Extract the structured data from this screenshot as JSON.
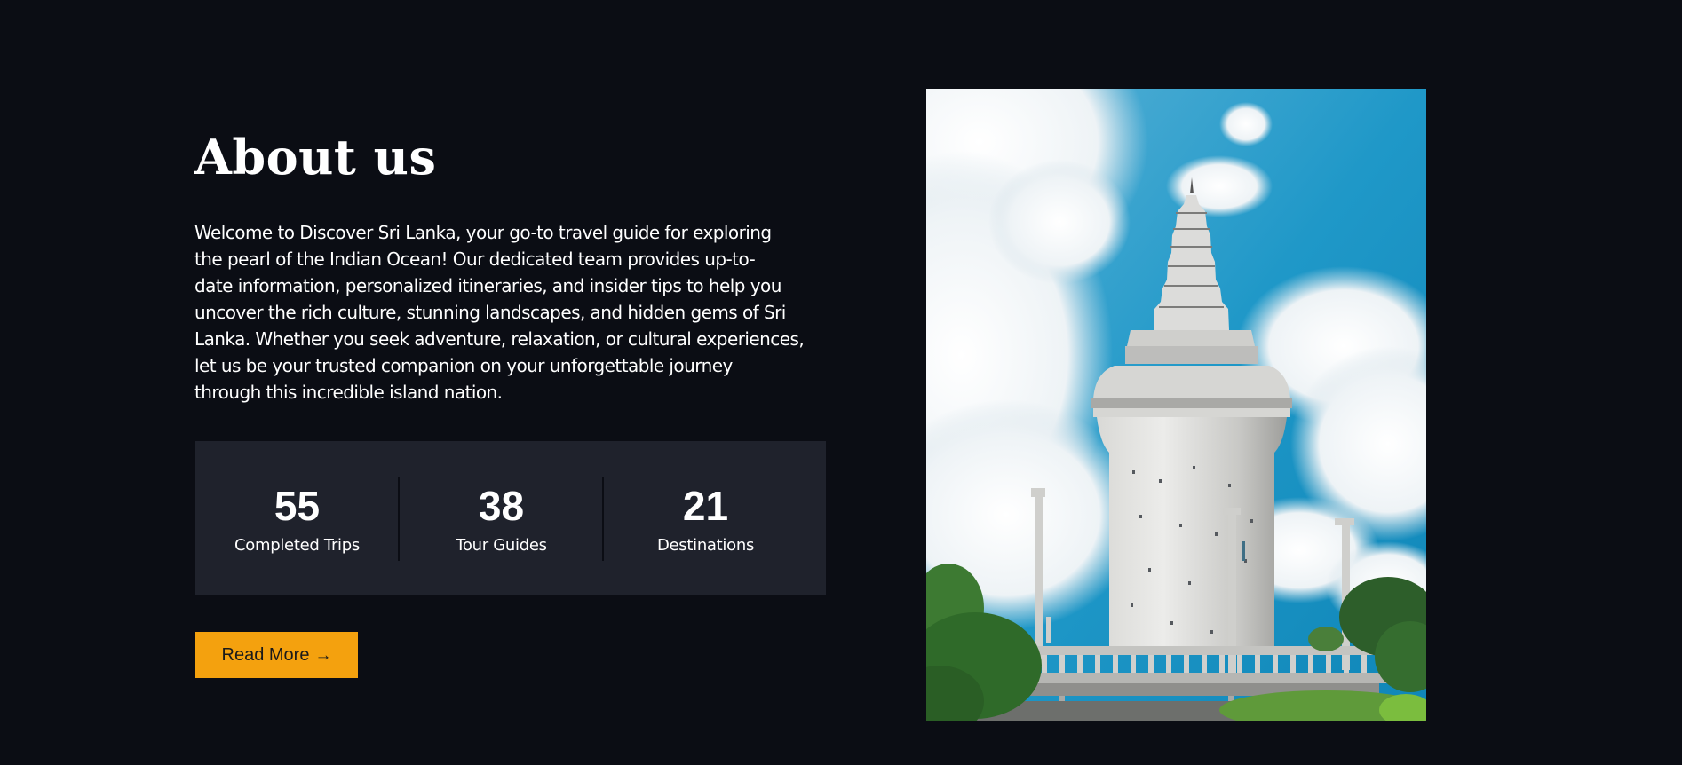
{
  "about": {
    "title": "About us",
    "description_lines": [
      "Welcome to Discover Sri Lanka, your go-to travel guide for exploring",
      "the pearl of the Indian Ocean! Our dedicated team provides up-to-",
      "date information, personalized itineraries, and insider tips to help you",
      "uncover the rich culture, stunning landscapes, and hidden gems of Sri",
      "Lanka. Whether you seek adventure, relaxation, or cultural experiences,",
      "let us be your trusted companion on your unforgettable journey",
      "through this incredible island nation."
    ],
    "stats": [
      {
        "value": "55",
        "label": "Completed Trips"
      },
      {
        "value": "38",
        "label": "Tour Guides"
      },
      {
        "value": "21",
        "label": "Destinations"
      }
    ],
    "read_more_label": "Read More",
    "read_more_icon": "arrow-right-icon"
  },
  "colors": {
    "background": "#0b0d14",
    "stats_panel": "#1f222c",
    "accent": "#f4a10e",
    "text": "#ffffff"
  }
}
